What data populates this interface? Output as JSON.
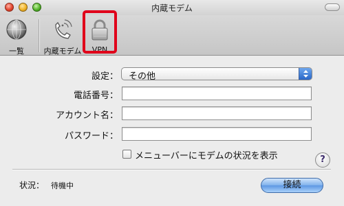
{
  "window": {
    "title": "内蔵モデム"
  },
  "toolbar": {
    "items": [
      {
        "label": "一覧",
        "icon": "globe-icon"
      },
      {
        "label": "内蔵モデム",
        "icon": "phone-icon"
      },
      {
        "label": "VPN",
        "icon": "lock-icon",
        "selected": true
      }
    ]
  },
  "form": {
    "settings_label": "設定：",
    "settings_value": "その他",
    "phone_label": "電話番号：",
    "phone_value": "",
    "account_label": "アカウント名：",
    "account_value": "",
    "password_label": "パスワード：",
    "password_value": "",
    "menubar_checkbox_label": "メニューバーにモデムの状況を表示",
    "menubar_checkbox_checked": false
  },
  "help": {
    "label": "?"
  },
  "status": {
    "label": "状況：",
    "value": "待機中"
  },
  "actions": {
    "connect_label": "接続"
  },
  "colors": {
    "highlight": "#e0001a",
    "accent": "#5d97e3"
  }
}
